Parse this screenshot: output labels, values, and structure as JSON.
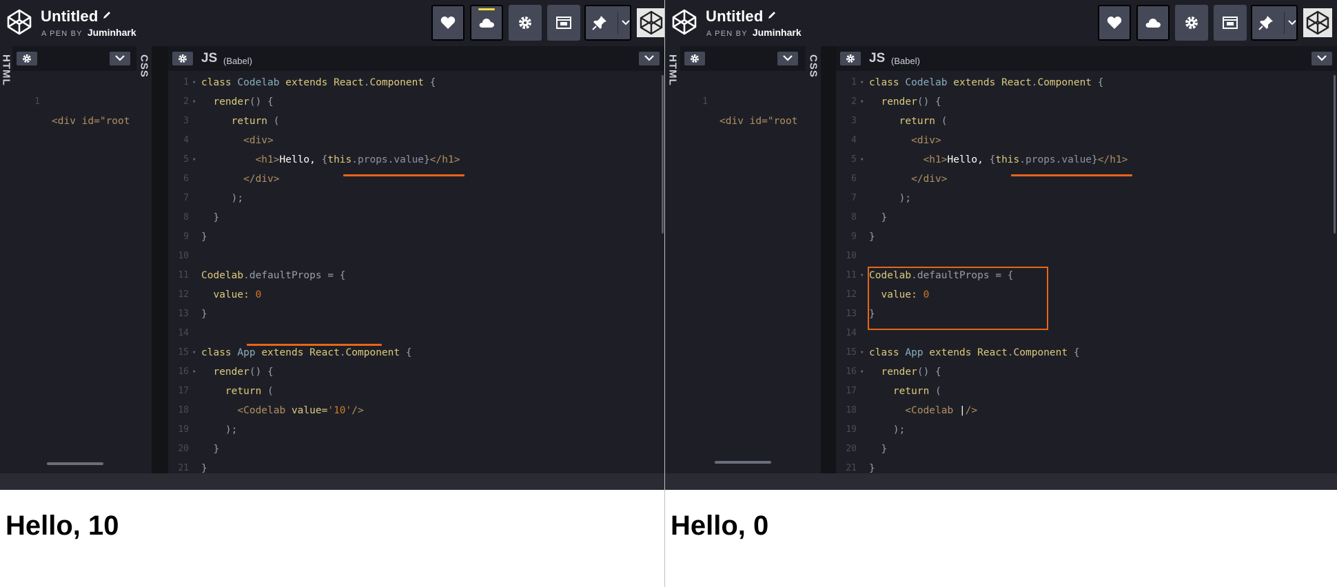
{
  "colors": {
    "header_bg": "#1e1f26",
    "editor_bg": "#1e1f26",
    "button_bg": "#444857",
    "active_indicator": "#f6df3b",
    "annotation": "#e7651a",
    "keyword": "#ddca7e",
    "class_name": "#88afbf",
    "tag": "#b28f63",
    "number": "#d0782a"
  },
  "panes": [
    {
      "id": "left",
      "header": {
        "title": "Untitled",
        "pen_label": "A PEN BY",
        "author": "Juminhark"
      },
      "toolbar": {
        "buttons": [
          "heart-icon",
          "cloud-icon",
          "gear-icon",
          "embed-icon",
          "pin-icon",
          "chevron-down-icon"
        ]
      },
      "html_panel": {
        "tab_label": "HTML",
        "line_number": "1",
        "code": "<div id=\"root"
      },
      "css_panel": {
        "tab_label": "CSS"
      },
      "js_panel": {
        "title": "JS",
        "subtitle": "(Babel)"
      },
      "output": {
        "heading": "Hello, 10"
      },
      "annotations": [
        "underline: {this.props.value}",
        "underline: <Codelab value='10'/>"
      ]
    },
    {
      "id": "right",
      "header": {
        "title": "Untitled",
        "pen_label": "A PEN BY",
        "author": "Juminhark"
      },
      "toolbar": {
        "buttons": [
          "heart-icon",
          "cloud-icon",
          "gear-icon",
          "embed-icon",
          "pin-icon",
          "chevron-down-icon"
        ]
      },
      "html_panel": {
        "tab_label": "HTML",
        "line_number": "1",
        "code": "<div id=\"root"
      },
      "css_panel": {
        "tab_label": "CSS"
      },
      "js_panel": {
        "title": "JS",
        "subtitle": "(Babel)"
      },
      "output": {
        "heading": "Hello, 0"
      },
      "annotations": [
        "underline: {this.props.value}",
        "box: Codelab.defaultProps block"
      ]
    }
  ],
  "js_code": {
    "left": [
      {
        "n": "1",
        "fold": true,
        "t": [
          [
            "class ",
            "k"
          ],
          [
            "Codelab ",
            "cl"
          ],
          [
            "extends ",
            "k"
          ],
          [
            "React",
            "k"
          ],
          [
            ".",
            "p"
          ],
          [
            "Component ",
            "k"
          ],
          [
            "{",
            "p"
          ]
        ]
      },
      {
        "n": "2",
        "fold": true,
        "t": [
          [
            "  render",
            "k"
          ],
          [
            "() {",
            "p"
          ]
        ]
      },
      {
        "n": "3",
        "fold": false,
        "t": [
          [
            "     return ",
            "k"
          ],
          [
            "(",
            "p"
          ]
        ]
      },
      {
        "n": "4",
        "fold": false,
        "t": [
          [
            "       <div>",
            "tg"
          ]
        ]
      },
      {
        "n": "5",
        "fold": true,
        "t": [
          [
            "         <h1>",
            "tg"
          ],
          [
            "Hello, ",
            "w"
          ],
          [
            "{",
            "p"
          ],
          [
            "this",
            "k"
          ],
          [
            ".",
            "p"
          ],
          [
            "props",
            "pr"
          ],
          [
            ".",
            "p"
          ],
          [
            "value",
            "pr"
          ],
          [
            "}",
            "p"
          ],
          [
            "</h1>",
            "tg"
          ]
        ]
      },
      {
        "n": "6",
        "fold": false,
        "t": [
          [
            "       </div>",
            "tg"
          ]
        ]
      },
      {
        "n": "7",
        "fold": false,
        "t": [
          [
            "     );",
            "p"
          ]
        ]
      },
      {
        "n": "8",
        "fold": false,
        "t": [
          [
            "  }",
            "p"
          ]
        ]
      },
      {
        "n": "9",
        "fold": false,
        "t": [
          [
            "}",
            "p"
          ]
        ]
      },
      {
        "n": "10",
        "fold": false,
        "t": []
      },
      {
        "n": "11",
        "fold": false,
        "t": [
          [
            "Codelab",
            "k"
          ],
          [
            ".defaultProps = {",
            "p"
          ]
        ]
      },
      {
        "n": "12",
        "fold": false,
        "t": [
          [
            "  value: ",
            "k"
          ],
          [
            "0",
            "n"
          ]
        ]
      },
      {
        "n": "13",
        "fold": false,
        "t": [
          [
            "}",
            "p"
          ]
        ]
      },
      {
        "n": "14",
        "fold": false,
        "t": []
      },
      {
        "n": "15",
        "fold": true,
        "t": [
          [
            "class ",
            "k"
          ],
          [
            "App ",
            "cl"
          ],
          [
            "extends ",
            "k"
          ],
          [
            "React",
            "k"
          ],
          [
            ".",
            "p"
          ],
          [
            "Component ",
            "k"
          ],
          [
            "{",
            "p"
          ]
        ]
      },
      {
        "n": "16",
        "fold": true,
        "t": [
          [
            "  render",
            "k"
          ],
          [
            "() {",
            "p"
          ]
        ]
      },
      {
        "n": "17",
        "fold": false,
        "t": [
          [
            "    return ",
            "k"
          ],
          [
            "(",
            "p"
          ]
        ]
      },
      {
        "n": "18",
        "fold": false,
        "t": [
          [
            "      <Codelab ",
            "tg"
          ],
          [
            "value=",
            "k"
          ],
          [
            "'10'",
            "n"
          ],
          [
            "/>",
            "tg"
          ]
        ]
      },
      {
        "n": "19",
        "fold": false,
        "t": [
          [
            "    );",
            "p"
          ]
        ]
      },
      {
        "n": "20",
        "fold": false,
        "t": [
          [
            "  }",
            "p"
          ]
        ]
      },
      {
        "n": "21",
        "fold": false,
        "t": [
          [
            "}",
            "p"
          ]
        ]
      }
    ],
    "right": [
      {
        "n": "1",
        "fold": true,
        "t": [
          [
            "class ",
            "k"
          ],
          [
            "Codelab ",
            "cl"
          ],
          [
            "extends ",
            "k"
          ],
          [
            "React",
            "k"
          ],
          [
            ".",
            "p"
          ],
          [
            "Component ",
            "k"
          ],
          [
            "{",
            "p"
          ]
        ]
      },
      {
        "n": "2",
        "fold": true,
        "t": [
          [
            "  render",
            "k"
          ],
          [
            "() {",
            "p"
          ]
        ]
      },
      {
        "n": "3",
        "fold": false,
        "t": [
          [
            "     return ",
            "k"
          ],
          [
            "(",
            "p"
          ]
        ]
      },
      {
        "n": "4",
        "fold": false,
        "t": [
          [
            "       <div>",
            "tg"
          ]
        ]
      },
      {
        "n": "5",
        "fold": true,
        "t": [
          [
            "         <h1>",
            "tg"
          ],
          [
            "Hello, ",
            "w"
          ],
          [
            "{",
            "p"
          ],
          [
            "this",
            "k"
          ],
          [
            ".",
            "p"
          ],
          [
            "props",
            "pr"
          ],
          [
            ".",
            "p"
          ],
          [
            "value",
            "pr"
          ],
          [
            "}",
            "p"
          ],
          [
            "</h1>",
            "tg"
          ]
        ]
      },
      {
        "n": "6",
        "fold": false,
        "t": [
          [
            "       </div>",
            "tg"
          ]
        ]
      },
      {
        "n": "7",
        "fold": false,
        "t": [
          [
            "     );",
            "p"
          ]
        ]
      },
      {
        "n": "8",
        "fold": false,
        "t": [
          [
            "  }",
            "p"
          ]
        ]
      },
      {
        "n": "9",
        "fold": false,
        "t": [
          [
            "}",
            "p"
          ]
        ]
      },
      {
        "n": "10",
        "fold": false,
        "t": []
      },
      {
        "n": "11",
        "fold": true,
        "t": [
          [
            "Codelab",
            "k"
          ],
          [
            ".defaultProps = {",
            "p"
          ]
        ]
      },
      {
        "n": "12",
        "fold": false,
        "t": [
          [
            "  value: ",
            "k"
          ],
          [
            "0",
            "n"
          ]
        ]
      },
      {
        "n": "13",
        "fold": false,
        "t": [
          [
            "}",
            "p"
          ]
        ]
      },
      {
        "n": "14",
        "fold": false,
        "t": []
      },
      {
        "n": "15",
        "fold": true,
        "t": [
          [
            "class ",
            "k"
          ],
          [
            "App ",
            "cl"
          ],
          [
            "extends ",
            "k"
          ],
          [
            "React",
            "k"
          ],
          [
            ".",
            "p"
          ],
          [
            "Component ",
            "k"
          ],
          [
            "{",
            "p"
          ]
        ]
      },
      {
        "n": "16",
        "fold": true,
        "t": [
          [
            "  render",
            "k"
          ],
          [
            "() {",
            "p"
          ]
        ]
      },
      {
        "n": "17",
        "fold": false,
        "t": [
          [
            "    return ",
            "k"
          ],
          [
            "(",
            "p"
          ]
        ]
      },
      {
        "n": "18",
        "fold": false,
        "t": [
          [
            "      <Codelab ",
            "tg"
          ],
          [
            "|",
            "w"
          ],
          [
            "/>",
            "tg"
          ]
        ]
      },
      {
        "n": "19",
        "fold": false,
        "t": [
          [
            "    );",
            "p"
          ]
        ]
      },
      {
        "n": "20",
        "fold": false,
        "t": [
          [
            "  }",
            "p"
          ]
        ]
      },
      {
        "n": "21",
        "fold": false,
        "t": [
          [
            "}",
            "p"
          ]
        ]
      }
    ]
  }
}
